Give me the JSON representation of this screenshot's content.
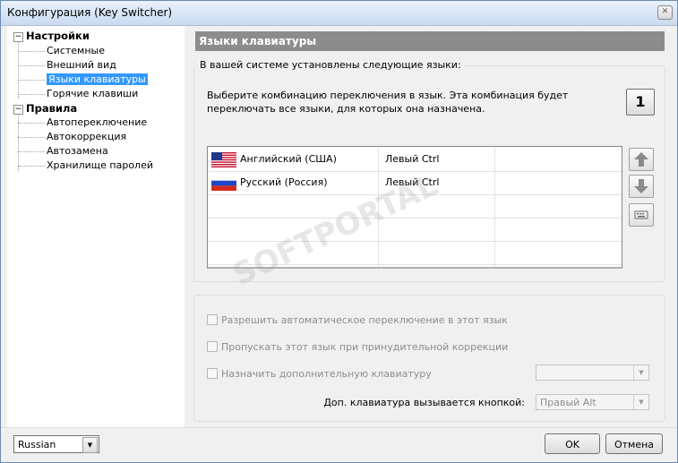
{
  "window": {
    "title": "Конфигурация (Key Switcher)",
    "close_glyph": "✕"
  },
  "tree": {
    "settings": {
      "label": "Настройки",
      "children": [
        "Системные",
        "Внешний вид",
        "Языки клавиатуры",
        "Горячие клавиши"
      ]
    },
    "rules": {
      "label": "Правила",
      "children": [
        "Автопереключение",
        "Автокоррекция",
        "Автозамена",
        "Хранилище паролей"
      ]
    },
    "selected": "Языки клавиатуры",
    "expander_glyph": "−"
  },
  "panel": {
    "title": "Языки клавиатуры",
    "group_label": "В вашей системе установлены следующие языки:",
    "description": "Выберите комбинацию переключения в язык. Эта комбинация будет переключать все языки, для которых она назначена.",
    "combo_number": "1",
    "languages": [
      {
        "name": "Английский (США)",
        "key": "Левый Ctrl",
        "flag": "us-flag"
      },
      {
        "name": "Русский (Россия)",
        "key": "Левый Ctrl",
        "flag": "ru-flag"
      }
    ],
    "options": {
      "auto_switch": "Разрешить автоматическое переключение в этот язык",
      "skip_forced": "Пропускать этот язык при принудительной коррекции",
      "extra_keyboard": "Назначить дополнительную клавиатуру",
      "extra_keyboard_value": "",
      "extra_key_label": "Доп. клавиатура вызывается кнопкой:",
      "extra_key_value": "Правый Alt"
    }
  },
  "bottom": {
    "ui_language": "Russian",
    "ok": "OK",
    "cancel": "Отмена",
    "dropdown_glyph": "▼"
  },
  "watermark": "SOFTPORTAL",
  "colors": {
    "selection": "#3399ff",
    "header": "#8c8c8c"
  }
}
